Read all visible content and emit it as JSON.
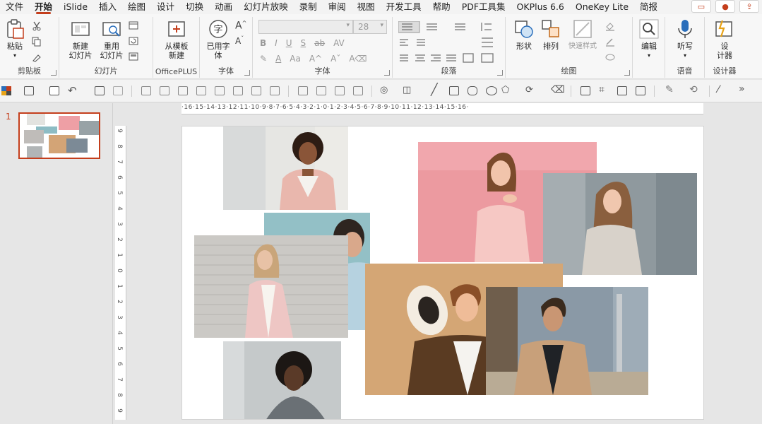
{
  "menu": {
    "tabs": [
      "文件",
      "开始",
      "iSlide",
      "插入",
      "绘图",
      "设计",
      "切换",
      "动画",
      "幻灯片放映",
      "录制",
      "审阅",
      "视图",
      "开发工具",
      "帮助",
      "PDF工具集",
      "OKPlus 6.6",
      "OneKey Lite",
      "简报"
    ],
    "active_tab": "开始"
  },
  "ribbon": {
    "clipboard": {
      "paste": "粘贴",
      "label": "剪贴板"
    },
    "slides": {
      "new_slide_l1": "新建",
      "new_slide_l2": "幻灯片",
      "reuse_l1": "重用",
      "reuse_l2": "幻灯片",
      "label": "幻灯片"
    },
    "officeplus": {
      "template_l1": "从模板",
      "template_l2": "新建",
      "label": "OfficePLUS"
    },
    "fonts_group": {
      "used_fonts_l1": "已用字",
      "used_fonts_l2": "体",
      "label": "字体"
    },
    "font": {
      "font_name": "",
      "font_size": "28",
      "label": "字体"
    },
    "paragraph": {
      "label": "段落"
    },
    "drawing": {
      "shapes": "形状",
      "arrange": "排列",
      "quick_styles": "快速样式",
      "label": "绘图"
    },
    "editing": {
      "edit": "编辑"
    },
    "voice": {
      "dictate": "听写",
      "label": "语音"
    },
    "designer": {
      "design_l1": "设",
      "design_l2": "计器",
      "label": "设计器"
    }
  },
  "ruler": {
    "horizontal": "·16·15·14·13·12·11·10·9·8·7·6·5·4·3·2·1·0·1·2·3·4·5·6·7·8·9·10·11·12·13·14·15·16·",
    "vertical": [
      "9",
      "8",
      "7",
      "6",
      "5",
      "4",
      "3",
      "2",
      "1",
      "0",
      "1",
      "2",
      "3",
      "4",
      "5",
      "6",
      "7",
      "8",
      "9"
    ]
  },
  "thumbnail_pane": {
    "slide_number": "1"
  },
  "colors": {
    "accent": "#c43e1c",
    "ribbon_bg": "#f7f7f7",
    "canvas_bg": "#e6e6e6"
  }
}
